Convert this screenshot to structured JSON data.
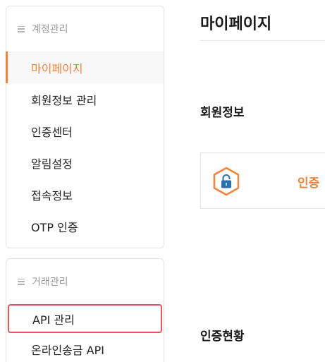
{
  "sidebar": {
    "account_group": {
      "title": "계정관리",
      "items": [
        {
          "label": "마이페이지",
          "active": true
        },
        {
          "label": "회원정보 관리"
        },
        {
          "label": "인증센터"
        },
        {
          "label": "알림설정"
        },
        {
          "label": "접속정보"
        },
        {
          "label": "OTP 인증"
        }
      ]
    },
    "trade_group": {
      "title": "거래관리",
      "items": [
        {
          "label": "API 관리",
          "highlighted": true
        },
        {
          "label": "온라인송금 API"
        }
      ]
    }
  },
  "main": {
    "page_title": "마이페이지",
    "member_section_title": "회원정보",
    "auth_card_label": "인증",
    "auth_status_title": "인증현황"
  },
  "colors": {
    "accent": "#f0843c",
    "highlight_border": "#e0565e",
    "lock_blue": "#2a6fb0"
  },
  "icons": {
    "menu": "hamburger-icon",
    "lock": "lock-icon"
  }
}
